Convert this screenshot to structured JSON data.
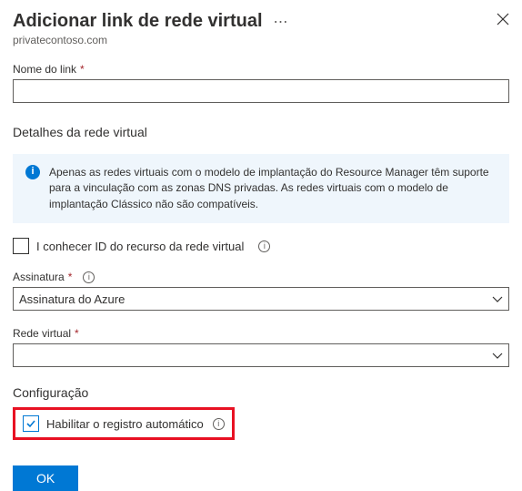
{
  "header": {
    "title": "Adicionar link de rede virtual",
    "subtitle": "privatecontoso.com"
  },
  "link_name": {
    "label": "Nome do link",
    "required": "*",
    "value": ""
  },
  "vnet_details": {
    "heading": "Detalhes da rede virtual",
    "info_banner": "Apenas as redes virtuais com o modelo de implantação do Resource Manager têm suporte para a vinculação com as zonas DNS privadas. As redes virtuais com o modelo de implantação Clássico não são compatíveis."
  },
  "resource_id_checkbox": {
    "label": "I conhecer ID do recurso da rede virtual",
    "checked": false
  },
  "subscription": {
    "label": "Assinatura",
    "required": "*",
    "selected": "Assinatura do Azure"
  },
  "vnet": {
    "label": "Rede virtual",
    "required": "*",
    "selected": ""
  },
  "config": {
    "heading": "Configuração",
    "auto_reg_label": "Habilitar o registro automático",
    "auto_reg_checked": true
  },
  "footer": {
    "ok": "OK"
  }
}
